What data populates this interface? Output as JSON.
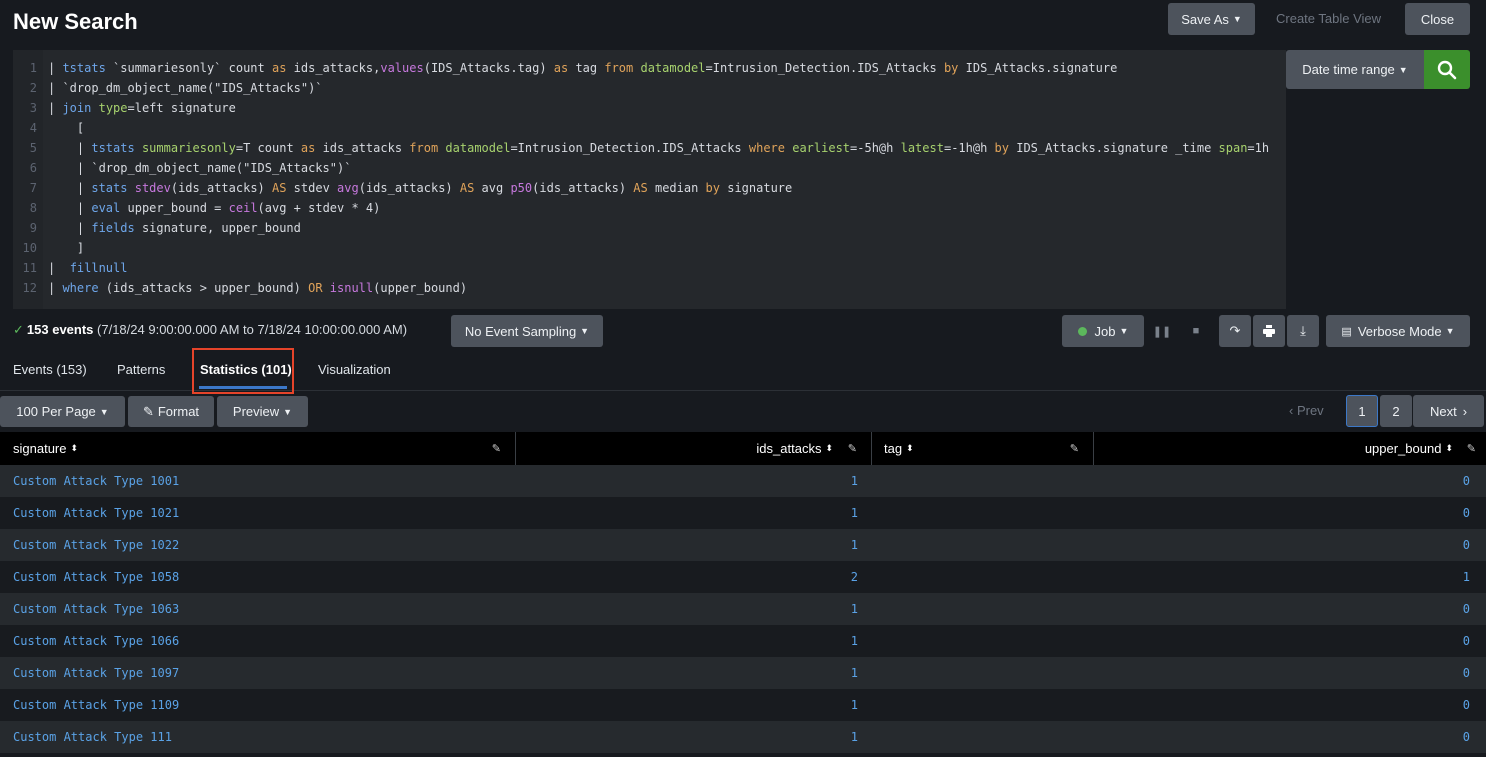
{
  "header": {
    "title": "New Search",
    "save_as": "Save As",
    "create_table_view": "Create Table View",
    "close": "Close"
  },
  "search": {
    "lines": [
      {
        "n": "1",
        "html": "| <span class='kw'>tstats</span> `summariesonly` count <span class='op'>as</span> ids_attacks,<span class='fn'>values</span>(IDS_Attacks.tag) <span class='op'>as</span> tag <span class='op'>from</span> <span class='arg'>datamodel</span>=Intrusion_Detection.IDS_Attacks <span class='op'>by</span> IDS_Attacks.signature"
      },
      {
        "n": "2",
        "html": "| `drop_dm_object_name(\"IDS_Attacks\")`"
      },
      {
        "n": "3",
        "html": "| <span class='kw'>join</span> <span class='arg'>type</span>=left signature"
      },
      {
        "n": "4",
        "html": "    ["
      },
      {
        "n": "5",
        "html": "    | <span class='kw'>tstats</span> <span class='arg'>summariesonly</span>=T count <span class='op'>as</span> ids_attacks <span class='op'>from</span> <span class='arg'>datamodel</span>=Intrusion_Detection.IDS_Attacks <span class='op'>where</span> <span class='arg'>earliest</span>=-5h@h <span class='arg'>latest</span>=-1h@h <span class='op'>by</span> IDS_Attacks.signature _time <span class='arg'>span</span>=1h"
      },
      {
        "n": "6",
        "html": "    | `drop_dm_object_name(\"IDS_Attacks\")`"
      },
      {
        "n": "7",
        "html": "    | <span class='kw'>stats</span> <span class='fn'>stdev</span>(ids_attacks) <span class='op'>AS</span> stdev <span class='fn'>avg</span>(ids_attacks) <span class='op'>AS</span> avg <span class='fn'>p50</span>(ids_attacks) <span class='op'>AS</span> median <span class='op'>by</span> signature"
      },
      {
        "n": "8",
        "html": "    | <span class='kw'>eval</span> upper_bound = <span class='fn'>ceil</span>(avg + stdev * 4)"
      },
      {
        "n": "9",
        "html": "    | <span class='kw'>fields</span> signature, upper_bound"
      },
      {
        "n": "10",
        "html": "    ]"
      },
      {
        "n": "11",
        "html": "|  <span class='kw'>fillnull</span>"
      },
      {
        "n": "12",
        "html": "| <span class='kw'>where</span> (ids_attacks &gt; upper_bound) <span class='op'>OR</span> <span class='fn'>isnull</span>(upper_bound)"
      }
    ],
    "date_range": "Date time range"
  },
  "status": {
    "check": "✓",
    "events": "153 events",
    "range": "(7/18/24 9:00:00.000 AM to 7/18/24 10:00:00.000 AM)",
    "sampling": "No Event Sampling",
    "job": "Job",
    "mode": "Verbose Mode"
  },
  "tabs": [
    {
      "label": "Events (153)"
    },
    {
      "label": "Patterns"
    },
    {
      "label": "Statistics (101)"
    },
    {
      "label": "Visualization"
    }
  ],
  "toolbar": {
    "per_page": "100 Per Page",
    "format": "Format",
    "preview": "Preview"
  },
  "pager": {
    "prev": "‹ Prev",
    "pages": [
      "1",
      "2"
    ],
    "next": "Next"
  },
  "table": {
    "columns": [
      "signature",
      "ids_attacks",
      "tag",
      "upper_bound"
    ],
    "rows": [
      {
        "signature": "Custom Attack Type 1001",
        "ids_attacks": "1",
        "tag": "",
        "upper_bound": "0"
      },
      {
        "signature": "Custom Attack Type 1021",
        "ids_attacks": "1",
        "tag": "",
        "upper_bound": "0"
      },
      {
        "signature": "Custom Attack Type 1022",
        "ids_attacks": "1",
        "tag": "",
        "upper_bound": "0"
      },
      {
        "signature": "Custom Attack Type 1058",
        "ids_attacks": "2",
        "tag": "",
        "upper_bound": "1"
      },
      {
        "signature": "Custom Attack Type 1063",
        "ids_attacks": "1",
        "tag": "",
        "upper_bound": "0"
      },
      {
        "signature": "Custom Attack Type 1066",
        "ids_attacks": "1",
        "tag": "",
        "upper_bound": "0"
      },
      {
        "signature": "Custom Attack Type 1097",
        "ids_attacks": "1",
        "tag": "",
        "upper_bound": "0"
      },
      {
        "signature": "Custom Attack Type 1109",
        "ids_attacks": "1",
        "tag": "",
        "upper_bound": "0"
      },
      {
        "signature": "Custom Attack Type 111",
        "ids_attacks": "1",
        "tag": "",
        "upper_bound": "0"
      }
    ]
  }
}
